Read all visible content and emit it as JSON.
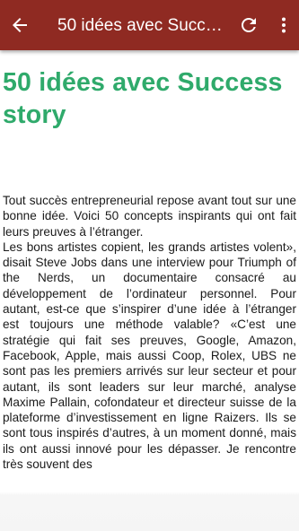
{
  "toolbar": {
    "title": "50 idées avec Success story",
    "back_icon": "arrow-left-icon",
    "refresh_icon": "refresh-icon",
    "menu_icon": "more-vert-icon",
    "background_color": "#8f2a22"
  },
  "article": {
    "title": "50 idées avec Success story",
    "title_color": "#2faa6b",
    "paragraphs": [
      "Tout succès entrepreneurial repose avant tout sur une bonne idée. Voici 50 concepts inspirants qui ont fait leurs preuves à l’étranger.",
      "Les bons artistes copient, les grands artistes volent», disait Steve Jobs dans une interview pour Triumph of the Nerds, un documentaire consacré au développement de l’ordinateur personnel. Pour autant, est-ce que s’inspirer d’une idée à l’étranger est toujours une méthode valable? «C’est une stratégie qui fait ses preuves, Google, Amazon, Facebook, Apple, mais aussi Coop, Rolex, UBS ne sont pas les premiers arrivés sur leur secteur et pour autant, ils sont leaders sur leur marché, analyse Maxime Pallain, cofondateur et directeur suisse de la plateforme d’investissement en ligne Raizers. Ils se sont tous inspirés d’autres, à un moment donné, mais ils ont aussi innové pour les dépasser. Je rencontre très souvent des"
    ]
  }
}
